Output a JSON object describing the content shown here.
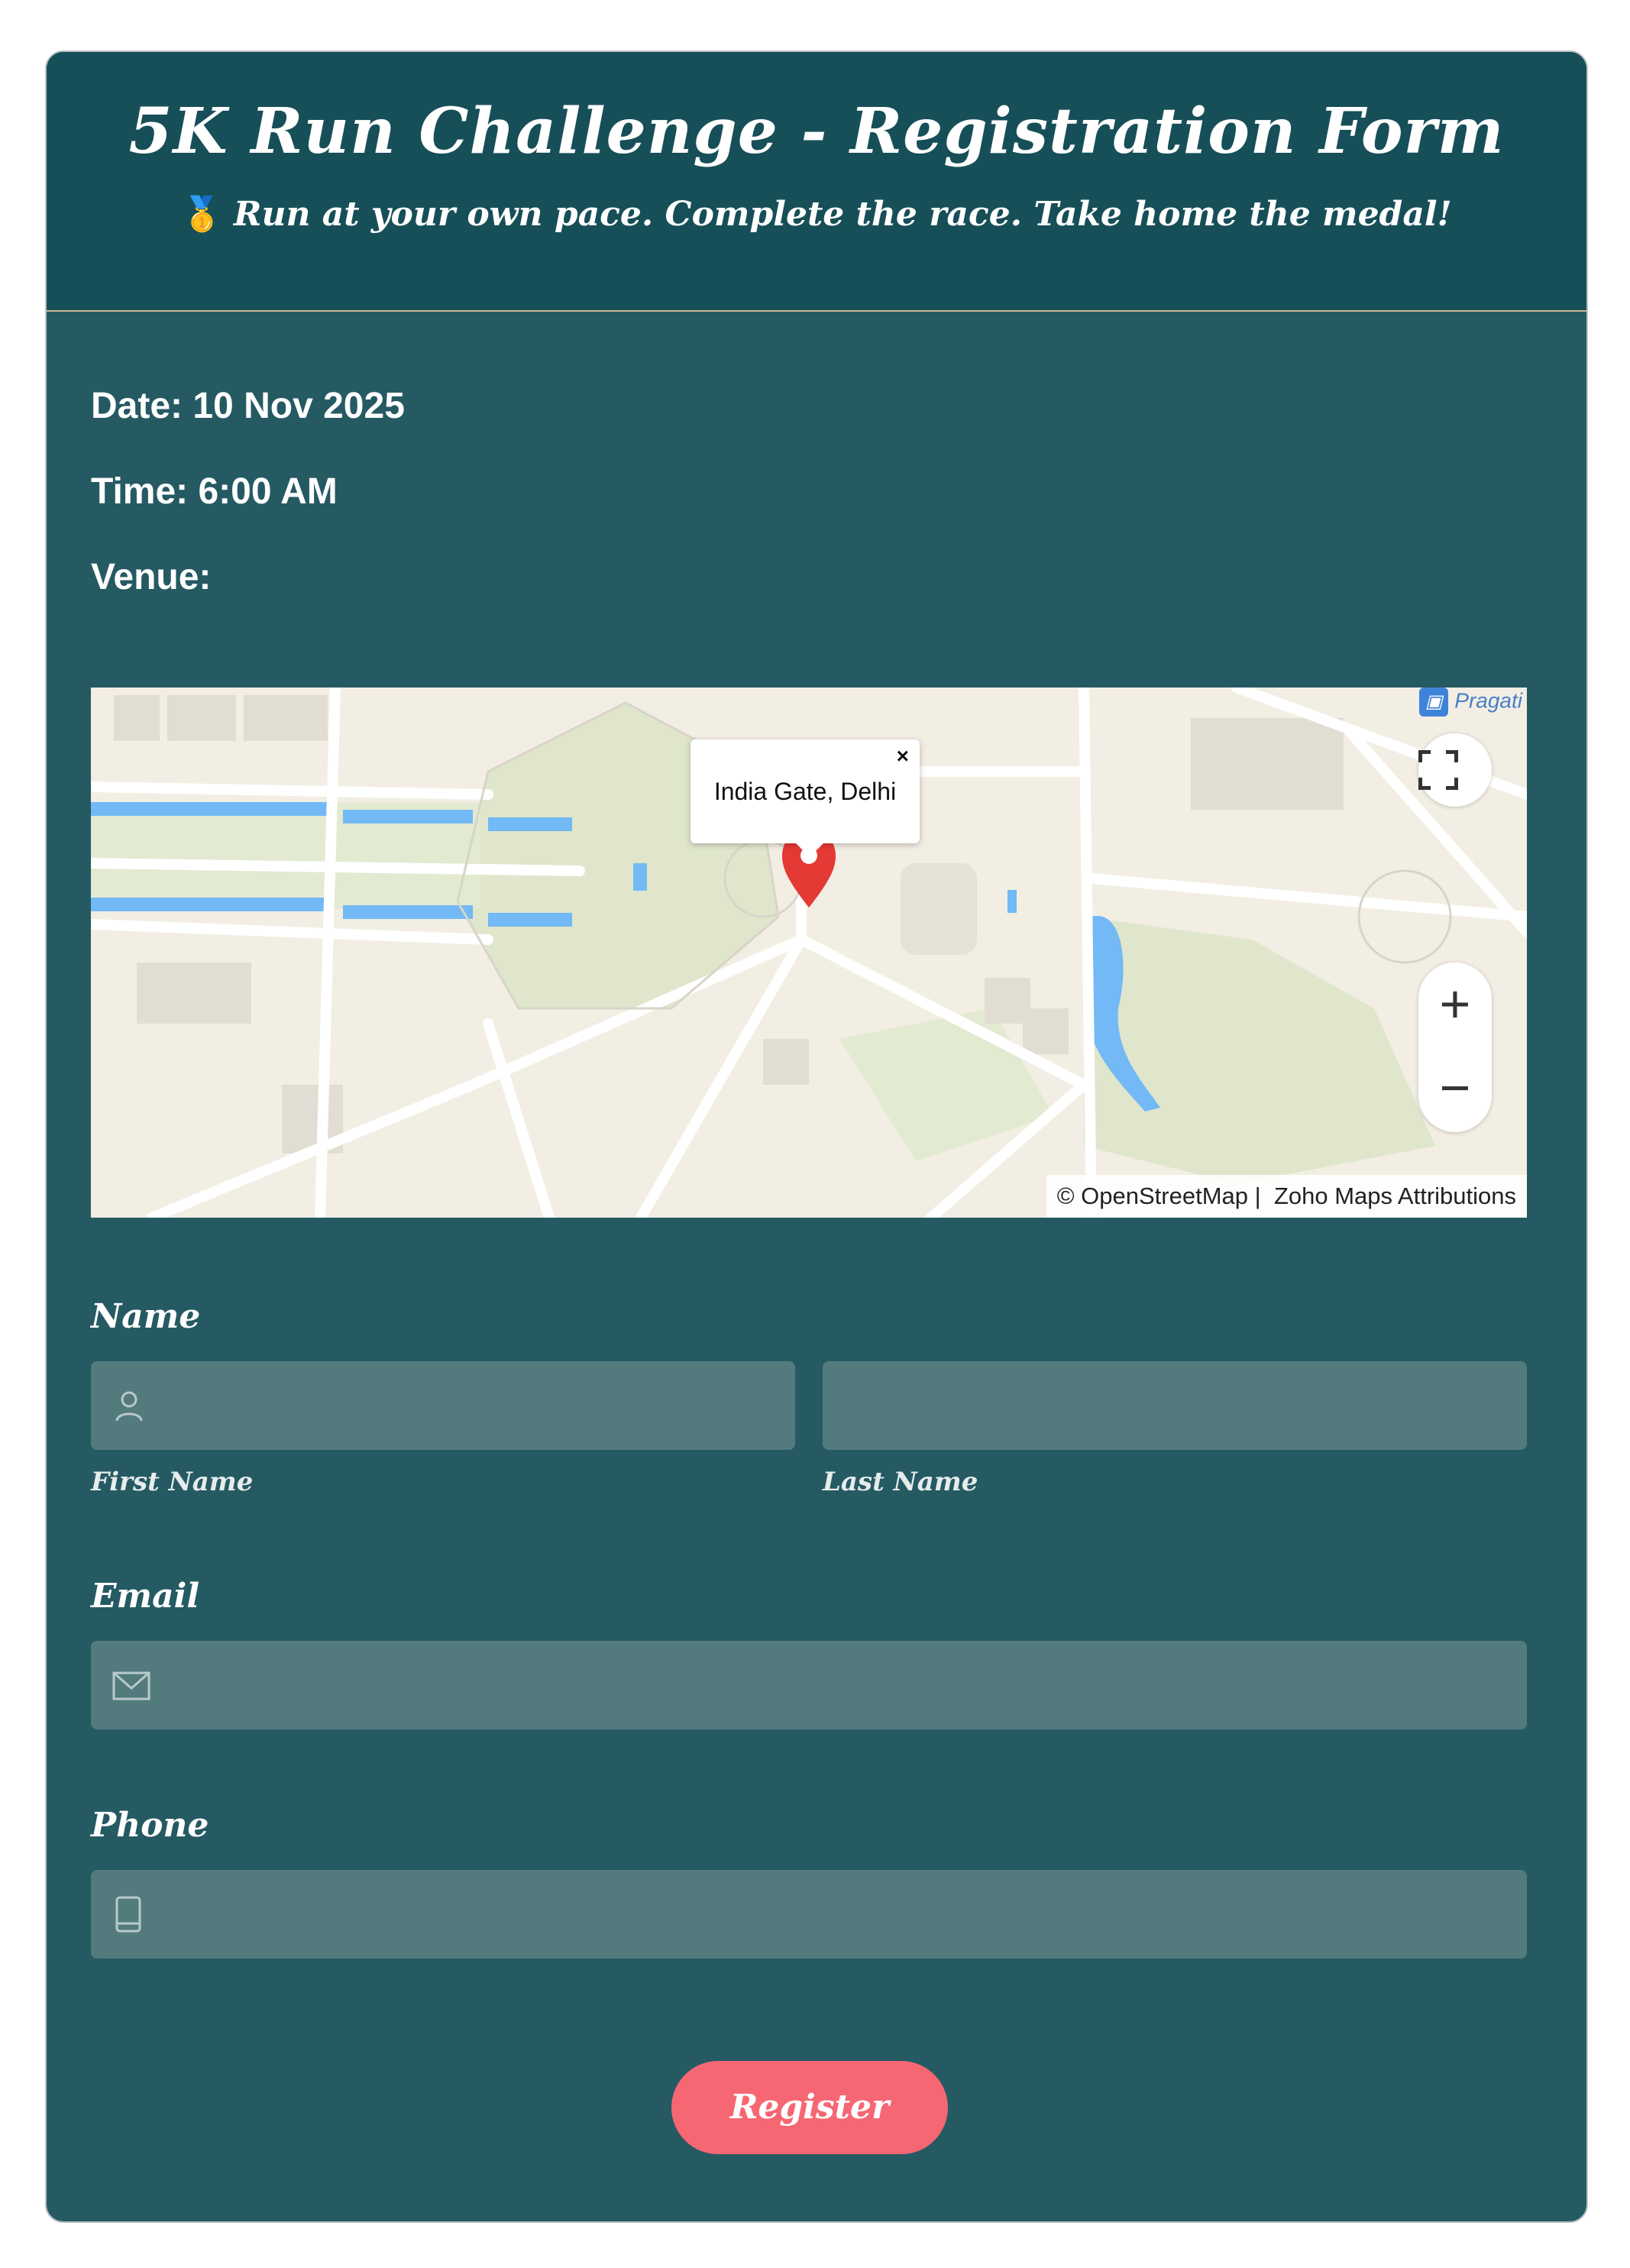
{
  "header": {
    "title": "5K Run Challenge - Registration Form",
    "medal_icon": "🥇",
    "subtitle": "Run at your own pace. Complete the race. Take home the medal!"
  },
  "event": {
    "date": "Date: 10 Nov 2025",
    "time": "Time: 6:00 AM",
    "venue": "Venue:"
  },
  "map": {
    "popup_label": "India Gate, Delhi",
    "close_glyph": "×",
    "station_label": "Pragati",
    "attribution_osm": "© OpenStreetMap",
    "attribution_separator": "|",
    "attribution_zoho": "Zoho Maps Attributions",
    "zoom_in": "+",
    "zoom_out": "−",
    "fullscreen_glyph": "⛶"
  },
  "form": {
    "name_label": "Name",
    "first_name_sublabel": "First Name",
    "last_name_sublabel": "Last Name",
    "first_name_value": "",
    "last_name_value": "",
    "email_label": "Email",
    "email_value": "",
    "phone_label": "Phone",
    "phone_value": "",
    "submit_label": "Register"
  },
  "colors": {
    "card_bg": "#255a63",
    "header_bg": "#174f58",
    "field_bg": "#537b7e",
    "button_bg": "#f66773"
  }
}
